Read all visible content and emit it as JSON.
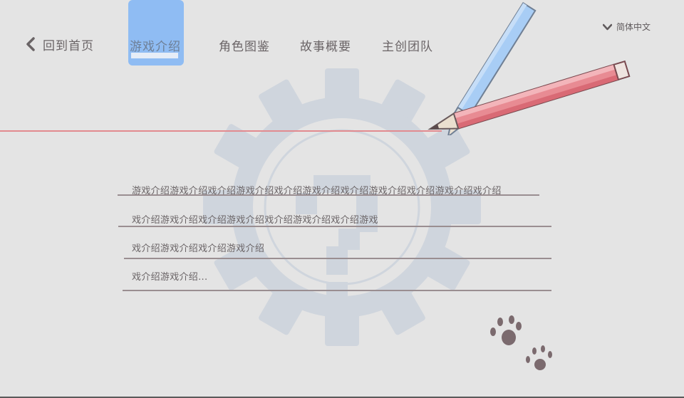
{
  "nav": {
    "back_label": "回到首页",
    "tabs": [
      {
        "label": "游戏介绍",
        "active": true
      },
      {
        "label": "角色图鉴",
        "active": false
      },
      {
        "label": "故事概要",
        "active": false
      },
      {
        "label": "主创团队",
        "active": false
      }
    ],
    "language_label": "简体中文"
  },
  "content": {
    "lines": [
      "游戏介绍游戏介绍戏介绍游戏介绍戏介绍游戏介绍戏介绍游戏介绍戏介绍游戏介绍戏介绍",
      "戏介绍游戏介绍戏介绍游戏介绍戏介绍游戏介绍戏介绍游戏",
      "戏介绍游戏介绍戏介绍游戏介绍",
      "戏介绍游戏介绍..."
    ]
  },
  "colors": {
    "background": "#e4e4e4",
    "active_tab_highlight": "#8fbcf3",
    "gear": "#cfd5dd",
    "red_line": "#e28a8f",
    "text": "#6a6466"
  },
  "icons": [
    "chevron-left-icon",
    "chevron-down-icon",
    "gear-question-icon",
    "pencil-icon",
    "paw-print-icon"
  ]
}
